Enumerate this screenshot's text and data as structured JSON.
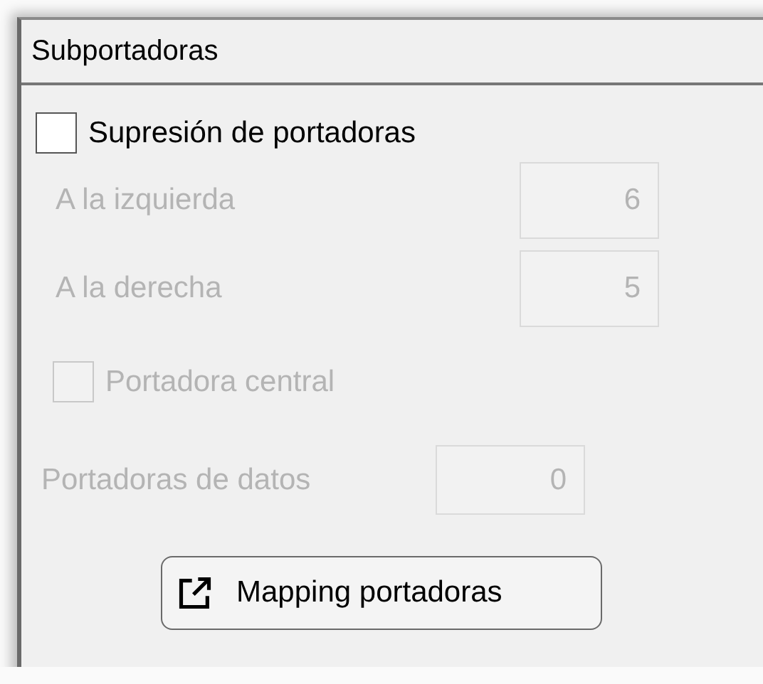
{
  "panel": {
    "title": "Subportadoras"
  },
  "suppression": {
    "label": "Supresión de portadoras",
    "checked": false
  },
  "sides": [
    {
      "label": "A la izquierda",
      "value": "6",
      "disabled": true
    },
    {
      "label": "A la derecha",
      "value": "5",
      "disabled": true
    }
  ],
  "central": {
    "label": "Portadora central",
    "checked": false,
    "disabled": true
  },
  "data_carriers": {
    "label": "Portadoras de datos",
    "value": "0",
    "disabled": true
  },
  "button": {
    "label": "Mapping portadoras"
  }
}
